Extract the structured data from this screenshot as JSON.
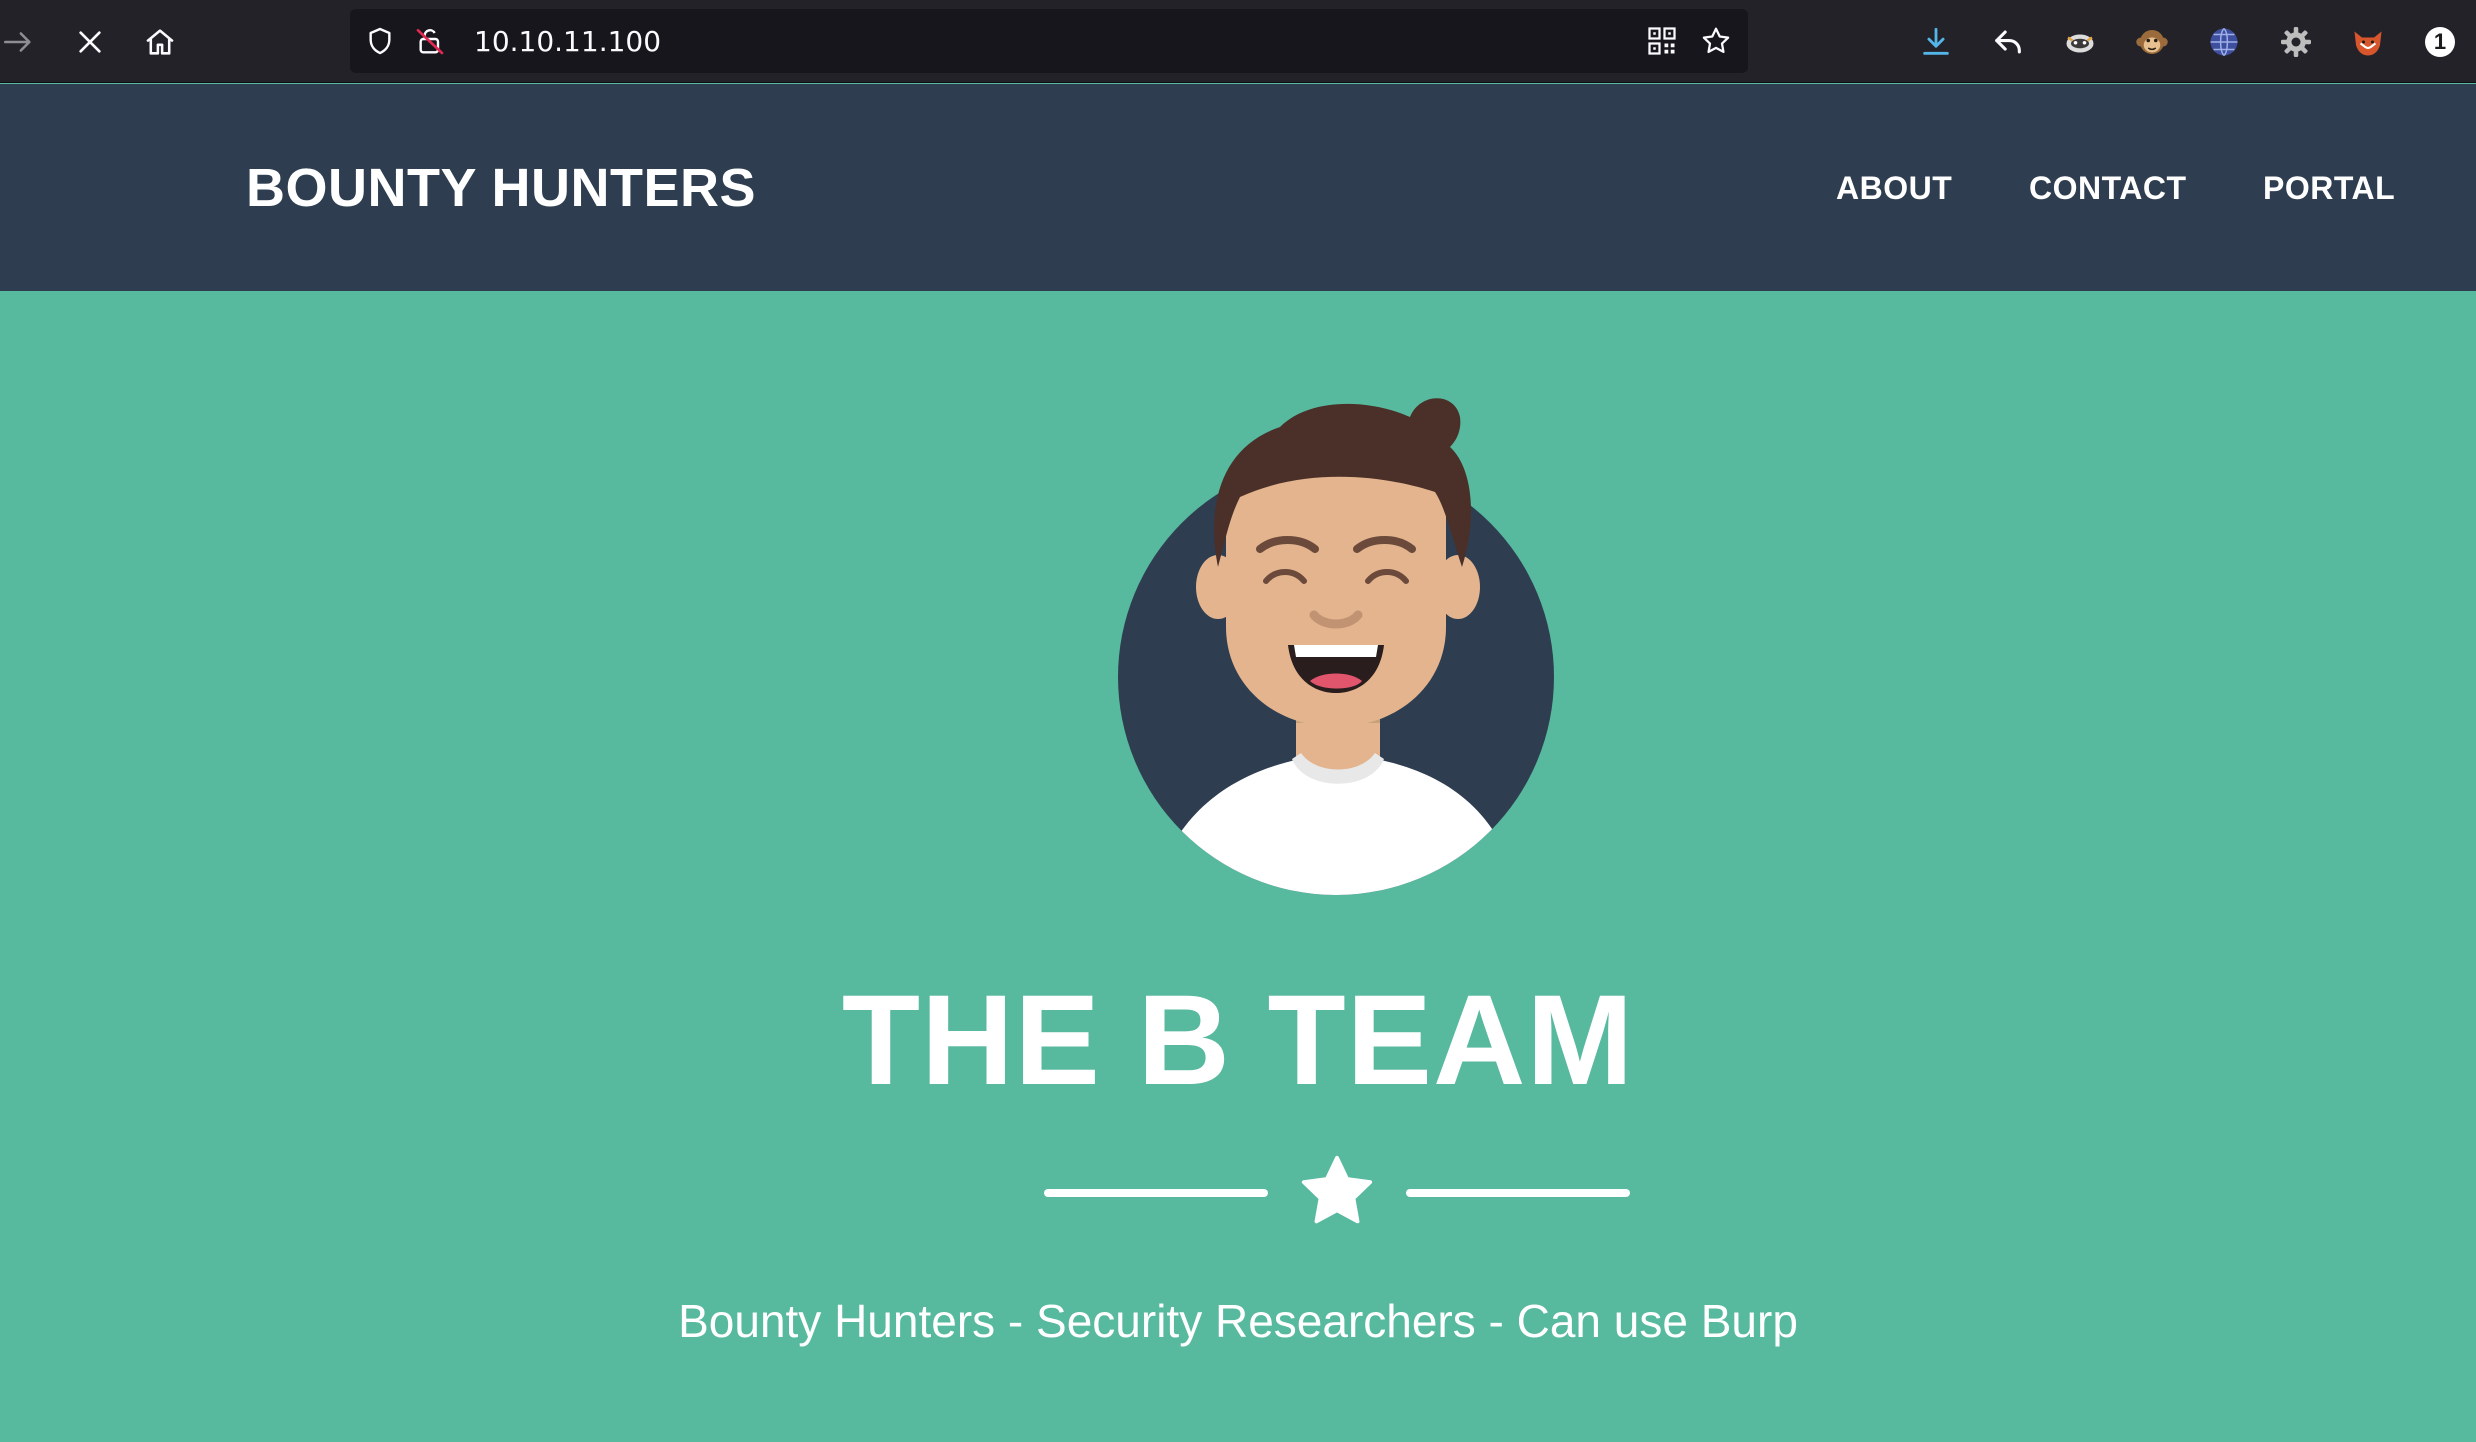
{
  "browser": {
    "url": "10.10.11.100",
    "buttons": [
      "forward-button",
      "stop-button",
      "home-button"
    ],
    "extensions_badge": "1"
  },
  "navbar": {
    "brand": "BOUNTY HUNTERS",
    "links": [
      "ABOUT",
      "CONTACT",
      "PORTAL"
    ]
  },
  "masthead": {
    "heading": "THE B TEAM",
    "subheading": "Bounty Hunters - Security Researchers - Can use Burp",
    "divider_icon": "star-icon"
  },
  "colors": {
    "navbar_bg": "#2e3e50",
    "masthead_bg": "#57b99e",
    "browser_bg": "#232229",
    "urlbar_bg": "#17161c"
  }
}
